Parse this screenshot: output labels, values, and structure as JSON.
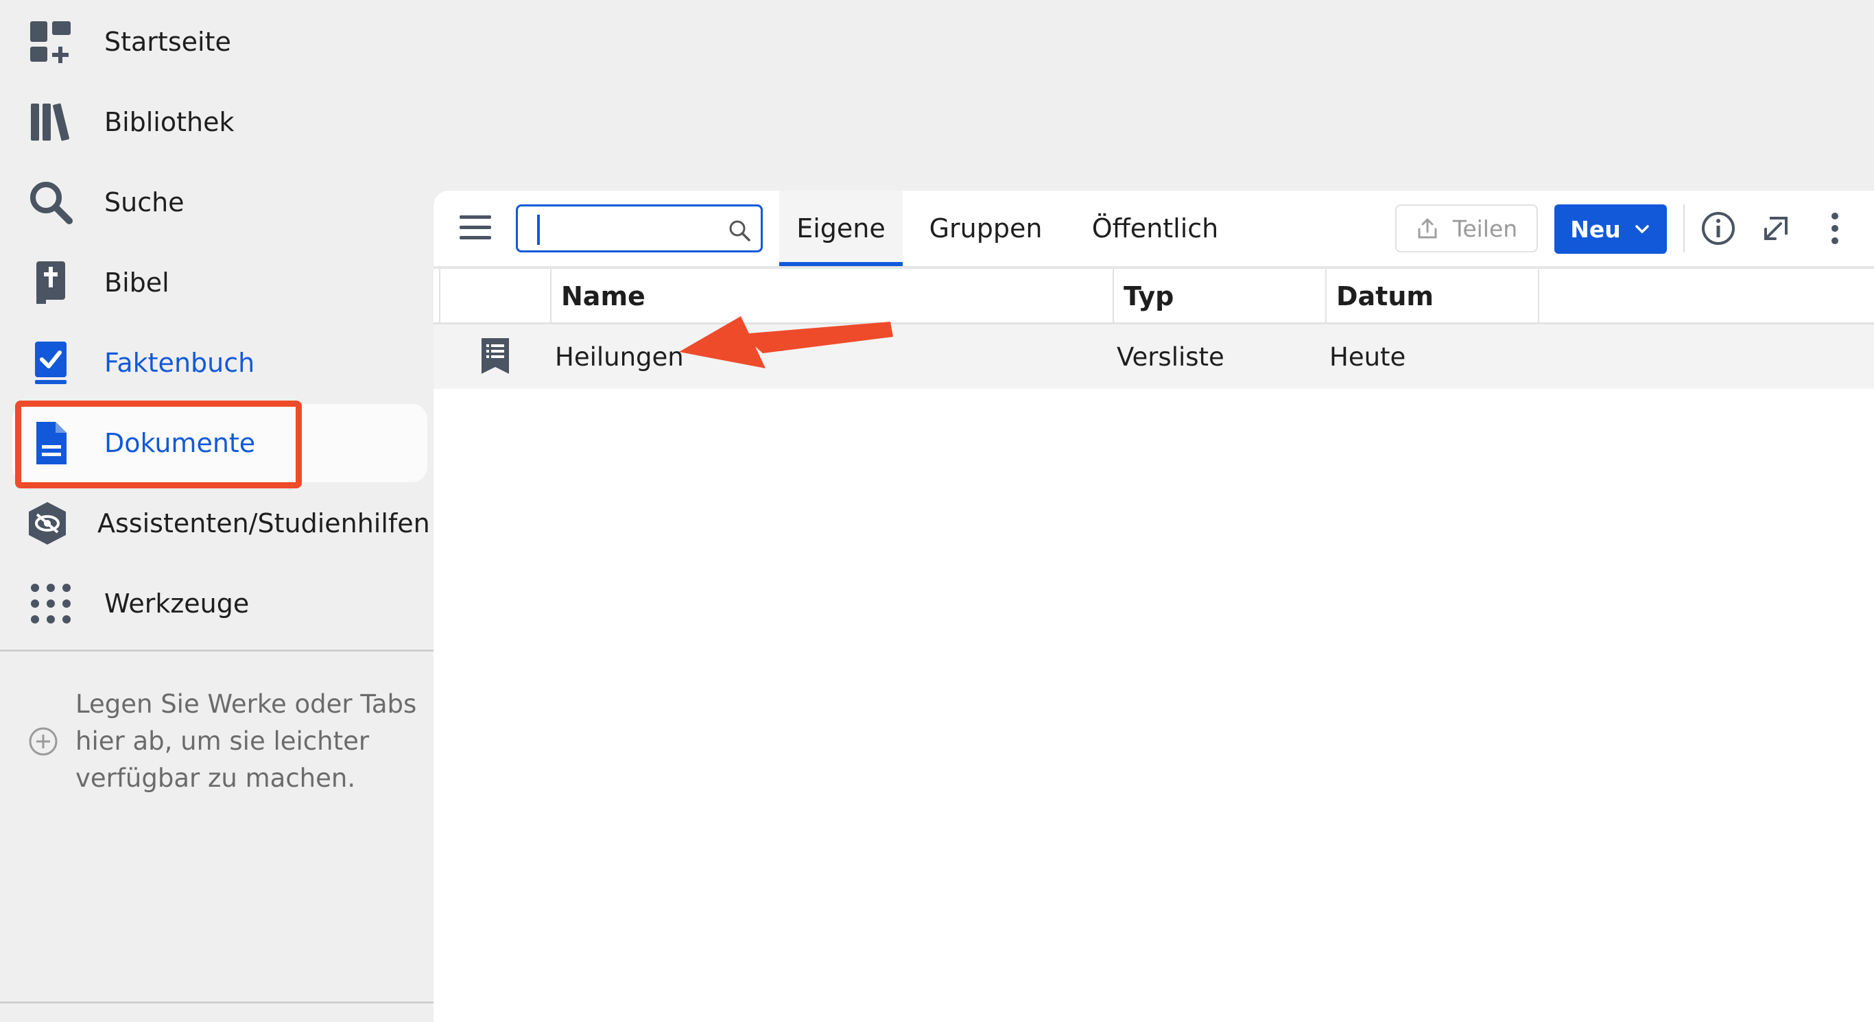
{
  "sidebar": {
    "items": [
      {
        "label": "Startseite",
        "icon": "dashboard-add-icon"
      },
      {
        "label": "Bibliothek",
        "icon": "library-books-icon"
      },
      {
        "label": "Suche",
        "icon": "search-icon"
      },
      {
        "label": "Bibel",
        "icon": "bible-book-icon"
      },
      {
        "label": "Faktenbuch",
        "icon": "factbook-check-icon"
      },
      {
        "label": "Dokumente",
        "icon": "document-icon"
      },
      {
        "label": "Assistenten/Studienhilfen",
        "icon": "guides-eye-icon"
      },
      {
        "label": "Werkzeuge",
        "icon": "tools-grid-icon"
      }
    ],
    "active_index": 5,
    "drop_hint": "Legen Sie Werke oder Tabs hier ab, um sie leichter verfügbar zu machen."
  },
  "toolbar": {
    "search_value": "",
    "tabs": [
      {
        "label": "Eigene",
        "active": true
      },
      {
        "label": "Gruppen",
        "active": false
      },
      {
        "label": "Öffentlich",
        "active": false
      }
    ],
    "share_label": "Teilen",
    "new_label": "Neu"
  },
  "table": {
    "columns": [
      "Name",
      "Typ",
      "Datum"
    ],
    "rows": [
      {
        "name": "Heilungen",
        "type": "Versliste",
        "date": "Heute",
        "icon": "verse-list-icon"
      }
    ]
  },
  "colors": {
    "accent": "#1259d9",
    "annotation": "#ee4b2b",
    "icon_gray": "#4a5462"
  }
}
